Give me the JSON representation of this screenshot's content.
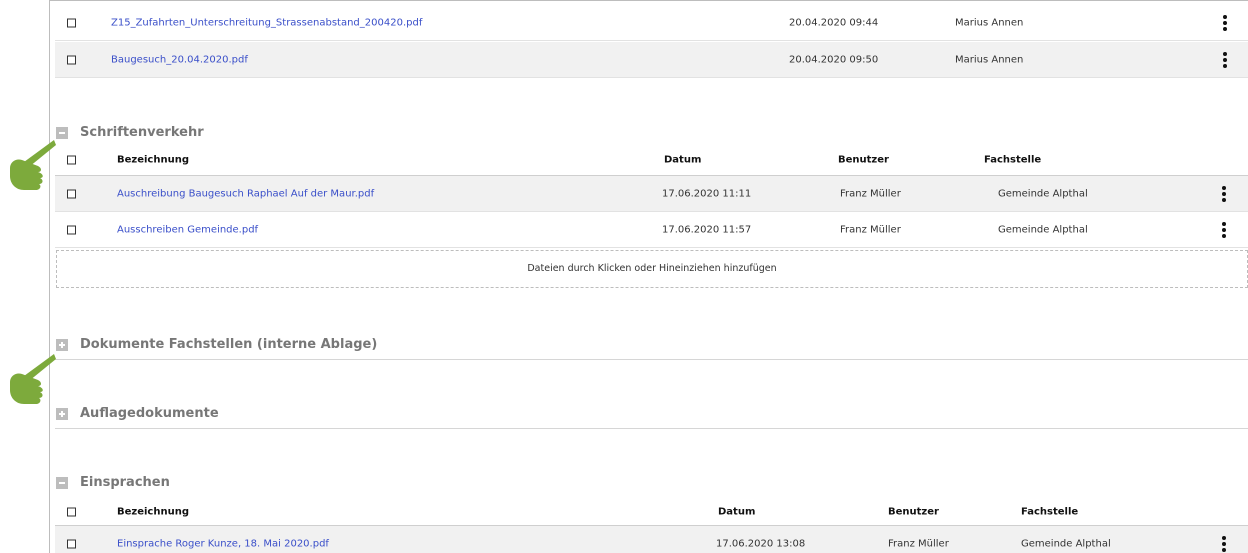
{
  "top_files": [
    {
      "name": "Z15_Zufahrten_Unterschreitung_Strassenabstand_200420.pdf",
      "date": "20.04.2020 09:44",
      "user": "Marius Annen"
    },
    {
      "name": "Baugesuch_20.04.2020.pdf",
      "date": "20.04.2020 09:50",
      "user": "Marius Annen"
    }
  ],
  "sections": {
    "schriftenverkehr": {
      "title": "Schriftenverkehr",
      "columns": {
        "bezeichnung": "Bezeichnung",
        "datum": "Datum",
        "benutzer": "Benutzer",
        "fachstelle": "Fachstelle"
      },
      "rows": [
        {
          "name": "Auschreibung Baugesuch Raphael Auf der Maur.pdf",
          "date": "17.06.2020 11:11",
          "user": "Franz Müller",
          "office": "Gemeinde Alpthal"
        },
        {
          "name": "Ausschreiben Gemeinde.pdf",
          "date": "17.06.2020 11:57",
          "user": "Franz Müller",
          "office": "Gemeinde Alpthal"
        }
      ],
      "dropzone": "Dateien durch Klicken oder Hineinziehen hinzufügen"
    },
    "dokumente_fachstellen": {
      "title": "Dokumente Fachstellen (interne Ablage)"
    },
    "auflagedokumente": {
      "title": "Auflagedokumente"
    },
    "einsprachen": {
      "title": "Einsprachen",
      "columns": {
        "bezeichnung": "Bezeichnung",
        "datum": "Datum",
        "benutzer": "Benutzer",
        "fachstelle": "Fachstelle"
      },
      "rows": [
        {
          "name": "Einsprache Roger Kunze, 18. Mai 2020.pdf",
          "date": "17.06.2020 13:08",
          "user": "Franz Müller",
          "office": "Gemeinde Alpthal"
        }
      ]
    }
  },
  "colors": {
    "link": "#3a4fc9",
    "hand": "#7daa3c",
    "section_title": "#777777"
  }
}
